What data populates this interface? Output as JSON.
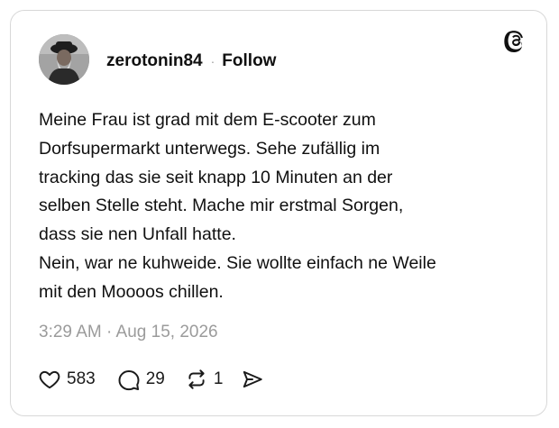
{
  "post": {
    "author": {
      "username": "zerotonin84",
      "separator": "·",
      "follow_label": "Follow",
      "avatar_icon": "profile-photo"
    },
    "platform_icon": "threads-logo-icon",
    "text_lines": [
      "Meine Frau ist grad mit dem E-scooter zum",
      "Dorfsupermarkt unterwegs. Sehe zufällig im",
      "tracking das sie seit knapp 10 Minuten an der",
      "selben Stelle steht. Mache mir erstmal Sorgen,",
      "dass sie nen Unfall hatte.",
      "Nein, war ne kuhweide. Sie wollte einfach ne Weile",
      "mit den Moooos chillen."
    ],
    "timestamp": "3:29 AM · Aug 15, 2026",
    "actions": {
      "likes": "583",
      "replies": "29",
      "reposts": "1"
    }
  },
  "colors": {
    "text": "#101010",
    "muted": "#9b9b9b",
    "border": "#d8d8d8",
    "background": "#ffffff"
  }
}
